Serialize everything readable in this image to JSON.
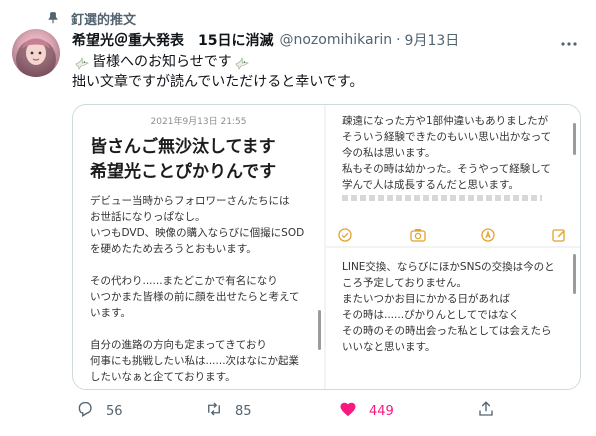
{
  "pinned": {
    "label": "釘選的推文",
    "icon": "pin-icon"
  },
  "author": {
    "display_name": "希望光＠重大発表　15日に消滅",
    "handle": "@nozomihikarin",
    "separator": "·",
    "date": "9月13日"
  },
  "tweet": {
    "line1_before": "",
    "line1_text": "皆様へのお知らせです",
    "line1_emoji": "dove-icon",
    "line2": "拙い文章ですが読んでいただけると幸いです。"
  },
  "media": {
    "memo": {
      "date": "2021年9月13日 21:55",
      "title_lines": [
        "皆さんご無沙汰してます",
        "希望光ことぴかりんです"
      ],
      "body_lines": [
        "デビュー当時からフォロワーさんたちには",
        "お世話になりっぱなし。",
        "いつもDVD、映像の購入ならびに個撮にSOD",
        "を硬めたため去ろうとおもいます。",
        "",
        "その代わり......またどこかで有名になり",
        "いつかまた皆様の前に顔を出せたらと考えて",
        "います。",
        "",
        "自分の進路の方向も定まってきており",
        "何事にも挑戦したい私は......次はなにか起業",
        "したいなぁと企てております。"
      ]
    },
    "top_right_lines": [
      "疎遠になった方や1部仲違いもありましたが",
      "そういう経験できたのもいい思い出かなって",
      "今の私は思います。",
      "私もその時は幼かった。そうやって経験して",
      "学んで人は成長するんだと思います。"
    ],
    "bottom_right_lines": [
      "LINE交換、ならびにほかSNSの交換は今のと",
      "ころ予定しておりません。",
      "またいつかお目にかかる日があれば",
      "その時は......ぴかりんとしてではなく",
      "その時のその時出会った私としては会えたら",
      "いいなと思います。"
    ]
  },
  "actions": {
    "reply_count": "56",
    "retweet_count": "85",
    "like_count": "449"
  },
  "colors": {
    "like": "#f91880",
    "secondary_text": "#536471",
    "memo_toolbar": "#e3a12f"
  }
}
